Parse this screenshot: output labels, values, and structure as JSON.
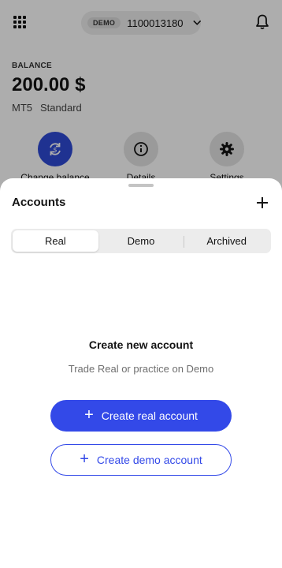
{
  "topbar": {
    "account_type_badge": "DEMO",
    "account_number": "1100013180",
    "chevron": "⌄"
  },
  "balance": {
    "label": "BALANCE",
    "value": "200.00 $",
    "platform": "MT5",
    "account_kind": "Standard"
  },
  "actions": [
    {
      "label": "Change balance",
      "icon": "refresh-icon"
    },
    {
      "label": "Details",
      "icon": "info-icon"
    },
    {
      "label": "Settings",
      "icon": "gear-icon"
    }
  ],
  "sheet": {
    "title": "Accounts",
    "add_icon": "plus-icon",
    "tabs": [
      {
        "label": "Real",
        "active": true
      },
      {
        "label": "Demo",
        "active": false
      },
      {
        "label": "Archived",
        "active": false
      }
    ],
    "empty_title": "Create new account",
    "empty_subtitle": "Trade Real or practice on Demo",
    "create_real_label": "Create real account",
    "create_demo_label": "Create demo account"
  },
  "colors": {
    "primary": "#3349e8",
    "overlay": "rgba(0,0,0,0.32)"
  }
}
